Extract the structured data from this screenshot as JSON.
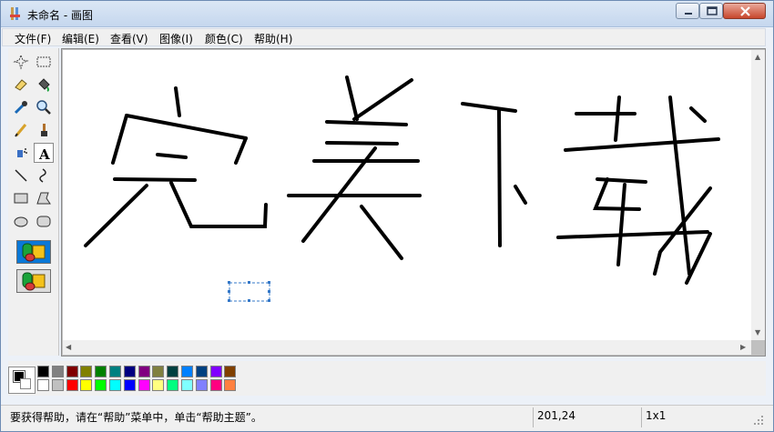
{
  "window": {
    "title": "未命名 - 画图"
  },
  "menu": [
    "文件(F)",
    "编辑(E)",
    "查看(V)",
    "图像(I)",
    "颜色(C)",
    "帮助(H)"
  ],
  "tools": [
    "free-form-select-icon",
    "select-icon",
    "eraser-icon",
    "fill-icon",
    "pick-color-icon",
    "magnifier-icon",
    "pencil-icon",
    "brush-icon",
    "airbrush-icon",
    "text-icon",
    "line-icon",
    "curve-icon",
    "rectangle-icon",
    "polygon-icon",
    "ellipse-icon",
    "rounded-rectangle-icon"
  ],
  "selected_tool": "text-icon",
  "text_tool_glyph": "A",
  "colors": {
    "foreground": "#000000",
    "background": "#ffffff",
    "row1": [
      "#000000",
      "#808080",
      "#800000",
      "#808000",
      "#008000",
      "#008080",
      "#000080",
      "#800080",
      "#808040",
      "#004040",
      "#0080ff",
      "#004080",
      "#8000ff",
      "#804000"
    ],
    "row2": [
      "#ffffff",
      "#c0c0c0",
      "#ff0000",
      "#ffff00",
      "#00ff00",
      "#00ffff",
      "#0000ff",
      "#ff00ff",
      "#ffff80",
      "#00ff80",
      "#80ffff",
      "#8080ff",
      "#ff0080",
      "#ff8040"
    ]
  },
  "status": {
    "help": "要获得帮助，请在“帮助”菜单中，单击“帮助主题”。",
    "coords": "201,24",
    "size": "1x1"
  }
}
